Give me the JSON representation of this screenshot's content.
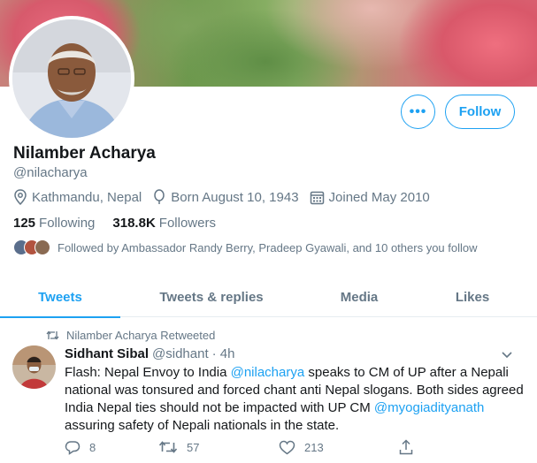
{
  "profile": {
    "name": "Nilamber Acharya",
    "handle": "@nilacharya",
    "location": "Kathmandu, Nepal",
    "born": "Born August 10, 1943",
    "joined": "Joined May 2010",
    "following_count": "125",
    "following_label": "Following",
    "followers_count": "318.8K",
    "followers_label": "Followers",
    "followed_by": "Followed by Ambassador Randy Berry, Pradeep Gyawali, and 10 others you follow"
  },
  "buttons": {
    "more": "•••",
    "follow": "Follow"
  },
  "tabs": [
    {
      "label": "Tweets",
      "active": true
    },
    {
      "label": "Tweets & replies",
      "active": false
    },
    {
      "label": "Media",
      "active": false
    },
    {
      "label": "Likes",
      "active": false
    }
  ],
  "tweet": {
    "retweeted_by": "Nilamber Acharya Retweeted",
    "author_name": "Sidhant Sibal",
    "author_handle": "@sidhant",
    "time": "· 4h",
    "text_1": "Flash: Nepal Envoy to India ",
    "mention_1": "@nilacharya",
    "text_2": " speaks to CM of UP after a Nepali national was tonsured and forced chant anti Nepal slogans.  Both sides agreed India Nepal ties should not be impacted with UP CM ",
    "mention_2": "@myogiadityanath",
    "text_3": " assuring safety of Nepali nationals in the state.",
    "replies": "8",
    "retweets": "57",
    "likes": "213"
  },
  "colors": {
    "accent": "#1da1f2",
    "secondary_text": "#657786",
    "primary_text": "#14171a"
  },
  "icons": [
    "location-icon",
    "birthday-icon",
    "calendar-icon",
    "retweet-icon",
    "chevron-down-icon",
    "reply-icon",
    "like-icon",
    "share-icon"
  ]
}
